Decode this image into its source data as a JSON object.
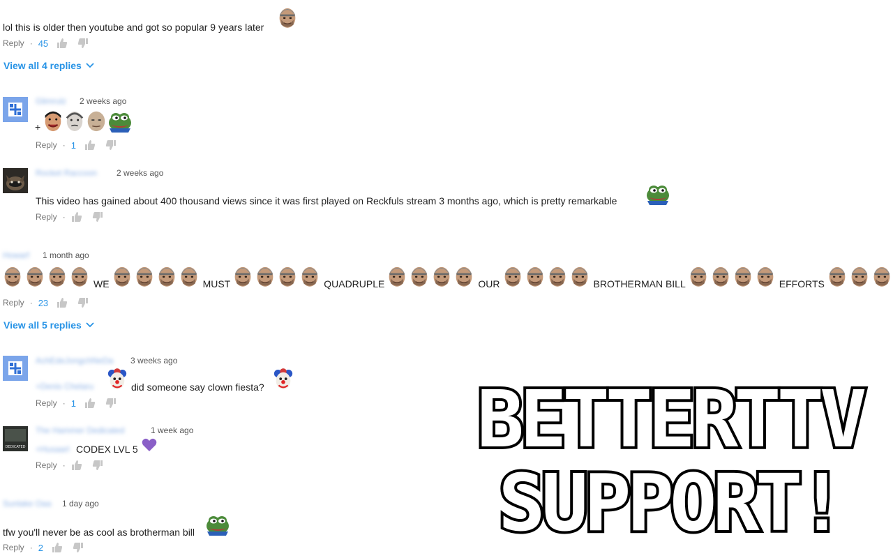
{
  "comments": [
    {
      "id": "c1",
      "author": "",
      "time": "",
      "text": "lol this is older then youtube and got so popular 9 years later",
      "reply_label": "Reply",
      "separator": "·",
      "likes": "45",
      "view_replies": "View all 4 replies"
    },
    {
      "id": "c2",
      "author": "Glimrulz",
      "time": "2 weeks ago",
      "plus": "+",
      "reply_label": "Reply",
      "separator": "·",
      "likes": "1"
    },
    {
      "id": "c3",
      "author": "Rocket Raccoon",
      "time": "2 weeks ago",
      "text": "This video has gained about 400 thousand views since it was first played on Reckfuls stream 3 months ago, which is pretty remarkable",
      "reply_label": "Reply",
      "separator": "·"
    },
    {
      "id": "c4",
      "author": "Howarf",
      "time": "1 month ago",
      "words": [
        "WE",
        "MUST",
        "QUADRUPLE",
        "OUR",
        "BROTHERMAN BILL",
        "EFFORTS"
      ],
      "reply_label": "Reply",
      "separator": "·",
      "likes": "23",
      "view_replies": "View all 5 replies"
    },
    {
      "id": "c5",
      "author": "AchEdeJongchNeDa",
      "time": "3 weeks ago",
      "mention": "+Denis Chelaru",
      "text": "did someone say clown fiesta?",
      "reply_label": "Reply",
      "separator": "·",
      "likes": "1"
    },
    {
      "id": "c6",
      "author": "The Hammer Dedicated",
      "time": "1 week ago",
      "mention": "+Husaarl",
      "text": "CODEX LVL 5",
      "reply_label": "Reply",
      "separator": "·",
      "avatar_caption": "DEDICATED"
    },
    {
      "id": "c7",
      "author": "Sunlake Oaa",
      "time": "1 day ago",
      "text": "tfw you'll never be as cool as brotherman bill",
      "reply_label": "Reply",
      "separator": "·",
      "likes": "2"
    }
  ],
  "banner": {
    "line1": "BETTERTTV",
    "line2": "SUPPORT!"
  },
  "colors": {
    "link_blue": "#2793e6",
    "meta_gray": "#767676",
    "avatar_blue": "#6f9fe8"
  },
  "icons": [
    "thumbs-up-icon",
    "thumbs-down-icon",
    "chevron-down-icon",
    "bald-man-emote",
    "pepe-frog-emote",
    "clown-emote",
    "purple-heart-icon"
  ]
}
